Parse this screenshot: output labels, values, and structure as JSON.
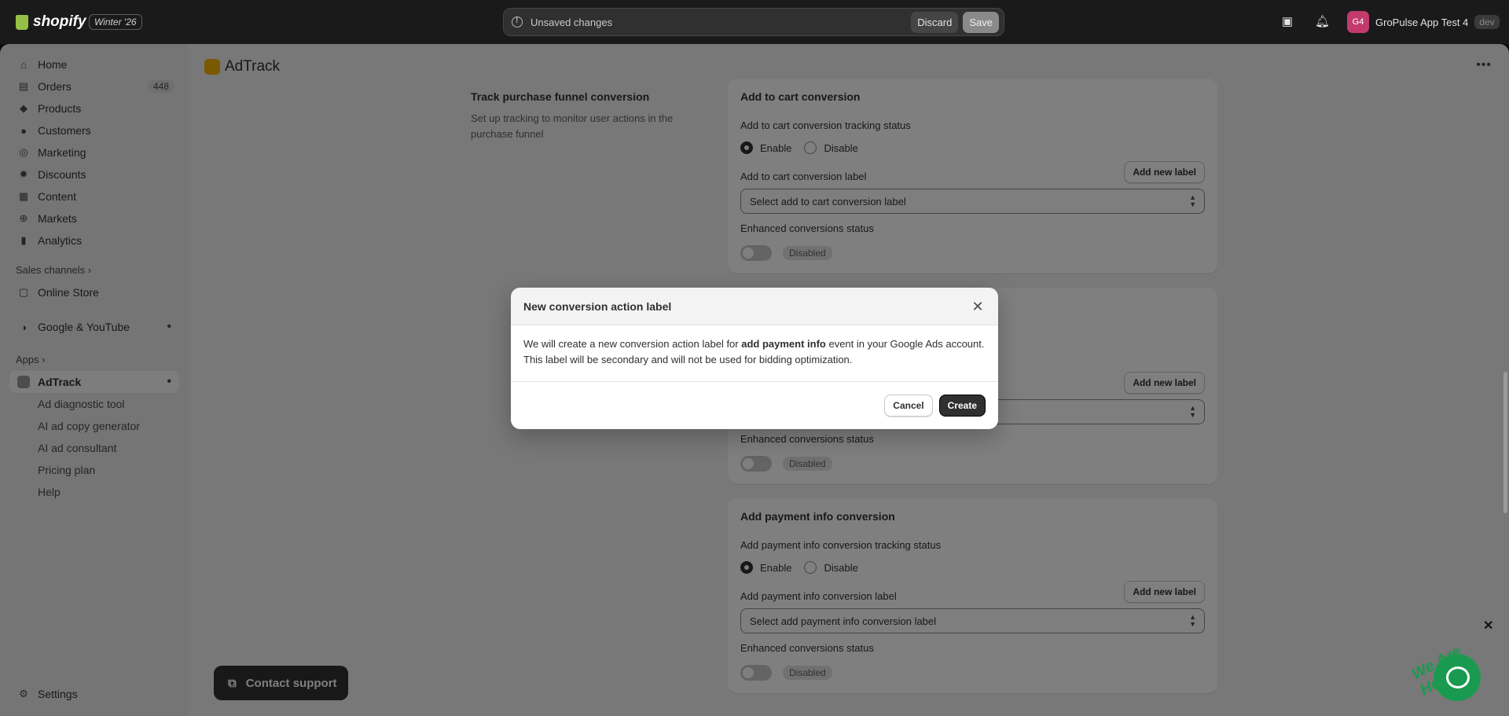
{
  "topbar": {
    "brand": "shopify",
    "edition": "Winter '26",
    "unsaved_text": "Unsaved changes",
    "discard_label": "Discard",
    "save_label": "Save",
    "store_initials": "G4",
    "store_name": "GroPulse App Test 4",
    "env_badge": "dev"
  },
  "sidebar": {
    "items": [
      {
        "label": "Home",
        "icon": "home-icon"
      },
      {
        "label": "Orders",
        "icon": "orders-icon",
        "badge": "448"
      },
      {
        "label": "Products",
        "icon": "tag-icon"
      },
      {
        "label": "Customers",
        "icon": "person-icon"
      },
      {
        "label": "Marketing",
        "icon": "target-icon"
      },
      {
        "label": "Discounts",
        "icon": "discount-icon"
      },
      {
        "label": "Content",
        "icon": "content-icon"
      },
      {
        "label": "Markets",
        "icon": "globe-icon"
      },
      {
        "label": "Analytics",
        "icon": "chart-icon"
      }
    ],
    "sales_channels_label": "Sales channels",
    "online_store": "Online Store",
    "google_youtube": "Google & YouTube",
    "apps_label": "Apps",
    "adtrack": "AdTrack",
    "adtrack_sub": [
      "Ad diagnostic tool",
      "AI ad copy generator",
      "AI ad consultant",
      "Pricing plan",
      "Help"
    ],
    "settings": "Settings"
  },
  "main": {
    "app_title": "AdTrack",
    "section_heading": "Track purchase funnel conversion",
    "section_desc": "Set up tracking to monitor user actions in the purchase funnel",
    "cards": [
      {
        "heading": "Add to cart conversion",
        "status_label": "Add to cart conversion tracking status",
        "enable": "Enable",
        "disable": "Disable",
        "label_label": "Add to cart conversion label",
        "add_new_label": "Add new label",
        "select_placeholder": "Select add to cart conversion label",
        "enhanced_label": "Enhanced conversions status",
        "enhanced_status": "Disabled"
      },
      {
        "add_new_label": "Add new label",
        "enhanced_label": "Enhanced conversions status",
        "enhanced_status": "Disabled"
      },
      {
        "heading": "Add payment info conversion",
        "status_label": "Add payment info conversion tracking status",
        "enable": "Enable",
        "disable": "Disable",
        "label_label": "Add payment info conversion label",
        "add_new_label": "Add new label",
        "select_placeholder": "Select add payment info conversion label",
        "enhanced_label": "Enhanced conversions status",
        "enhanced_status": "Disabled"
      }
    ],
    "contact_support": "Contact support"
  },
  "modal": {
    "title": "New conversion action label",
    "body_pre": "We will create a new conversion action label for ",
    "body_bold": "add payment info",
    "body_post": " event in your Google Ads account. This label will be secondary and will not be used for bidding optimization.",
    "cancel": "Cancel",
    "create": "Create"
  },
  "chat": {
    "banner": "We Are Here!"
  }
}
